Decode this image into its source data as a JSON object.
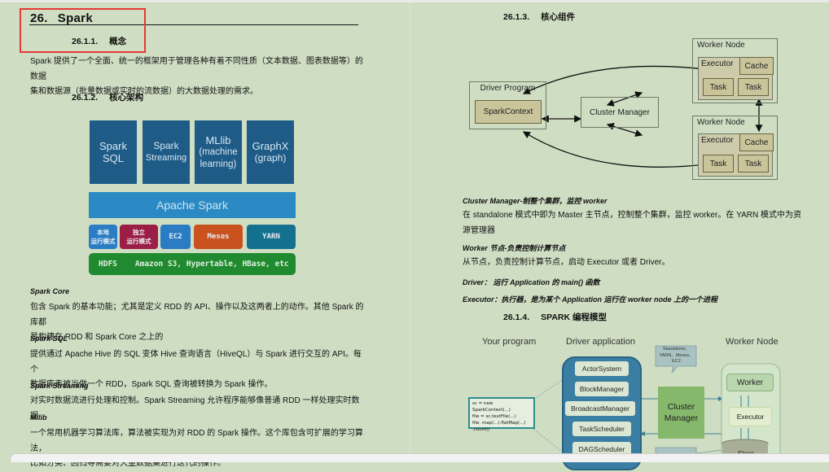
{
  "left_page": {
    "chapter": {
      "number": "26.",
      "title": "Spark"
    },
    "sec_concept": {
      "number": "26.1.1.",
      "title": "概念"
    },
    "concept_text_1": "Spark 提供了一个全面、统一的框架用于管理各种有着不同性质（文本数据、图表数据等）的数据",
    "concept_text_2": "集和数据源（批量数据或实时的流数据）的大数据处理的需求。",
    "sec_arch": {
      "number": "26.1.2.",
      "title": "核心架构"
    },
    "arch_diagram": {
      "libs": [
        {
          "l1": "Spark",
          "l2": "SQL",
          "l3": ""
        },
        {
          "l1": "Spark",
          "l2": "Streaming",
          "l3": ""
        },
        {
          "l1": "MLlib",
          "l2": "(machine",
          "l3": "learning)"
        },
        {
          "l1": "GraphX",
          "l2": "(graph)",
          "l3": ""
        }
      ],
      "core": "Apache Spark",
      "modes": [
        {
          "l1": "本地",
          "l2": "运行模式",
          "color": "#2a7cc4"
        },
        {
          "l1": "独立",
          "l2": "运行模式",
          "color": "#9c1d45"
        },
        {
          "l1": "EC2",
          "l2": "",
          "color": "#2a7cc4"
        },
        {
          "l1": "Mesos",
          "l2": "",
          "color": "#c9521f"
        },
        {
          "l1": "YARN",
          "l2": "",
          "color": "#13708f"
        }
      ],
      "storage_a": "HDFS",
      "storage_b": "Amazon S3, Hypertable, HBase, etc"
    },
    "spark_core": {
      "term": "Spark Core",
      "line1": "包含 Spark 的基本功能；尤其是定义 RDD 的 API、操作以及这两者上的动作。其他 Spark 的库都",
      "line2": "是构建在 RDD 和 Spark Core 之上的"
    },
    "spark_sql": {
      "term": "Spark SQL",
      "line1": "提供通过 Apache Hive 的 SQL 变体 Hive 查询语言（HiveQL）与 Spark 进行交互的 API。每个",
      "line2": "数据库表被当做一个 RDD，Spark SQL 查询被转换为 Spark 操作。"
    },
    "spark_streaming": {
      "term": "Spark Streaming",
      "line1": "对实时数据流进行处理和控制。Spark Streaming 允许程序能够像普通 RDD 一样处理实时数据"
    },
    "mllib": {
      "term": "Mllib",
      "line1": "一个常用机器学习算法库，算法被实现为对 RDD 的 Spark 操作。这个库包含可扩展的学习算法，",
      "line2": "比如分类、回归等需要对大量数据集进行迭代的操作。"
    }
  },
  "right_page": {
    "sec_components": {
      "number": "26.1.3.",
      "title": "核心组件"
    },
    "comp_diagram": {
      "driver_program": "Driver Program",
      "spark_context": "SparkContext",
      "cluster_manager": "Cluster Manager",
      "worker_node": "Worker Node",
      "executor": "Executor",
      "cache": "Cache",
      "task": "Task"
    },
    "cluster_manager": {
      "term": "Cluster Manager-制整个集群，监控 worker",
      "line1": "在 standalone 模式中即为 Master 主节点，控制整个集群，监控 worker。在 YARN 模式中为资",
      "line2": "源管理器"
    },
    "worker": {
      "term": "Worker 节点-负责控制计算节点",
      "line1": "从节点，负责控制计算节点，启动 Executor 或者 Driver。"
    },
    "driver": {
      "term": "Driver： 运行 Application 的 main() 函数"
    },
    "executor": {
      "term": "Executor：执行器，是为某个 Application 运行在 worker node 上的一个进程"
    },
    "sec_model": {
      "number": "26.1.4.",
      "title": "SPARK 编程模型"
    },
    "model_diagram": {
      "your_program": "Your program",
      "driver_application": "Driver application",
      "worker_node": "Worker Node",
      "code_lines": [
        "sc = new SparkContext(...)",
        "file = sc.textFile(...)",
        "file. map(...).flatMap(...)",
        ".count()"
      ],
      "driver_items": [
        "ActorSystem",
        "BlockManager",
        "BroadcastManager",
        "TaskScheduler",
        "DAGScheduler"
      ],
      "callout": "Standalone、YARN、Mesos、EC2",
      "cluster_manager_l1": "Cluster",
      "cluster_manager_l2": "Manager",
      "worker": "Worker",
      "executor": "Executor",
      "store": "Store"
    }
  }
}
